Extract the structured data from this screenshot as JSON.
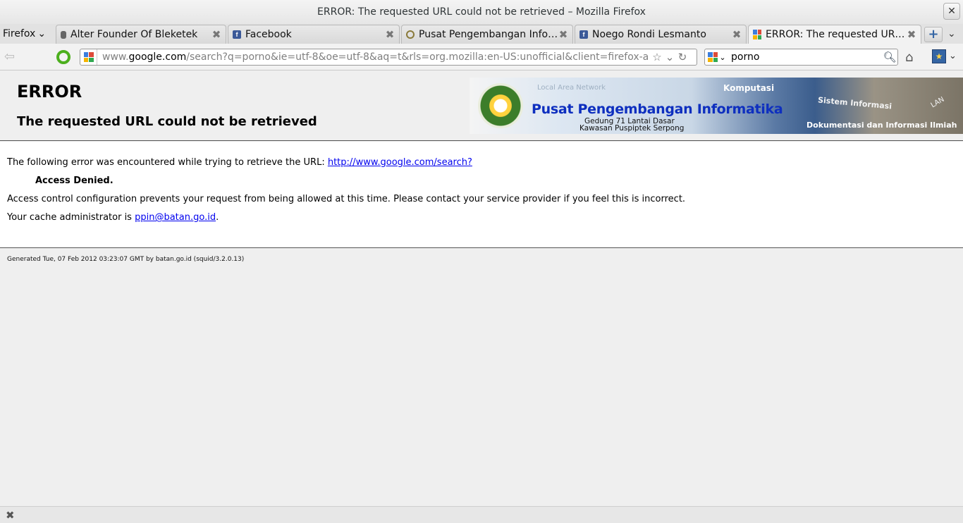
{
  "window": {
    "title": "ERROR: The requested URL could not be retrieved – Mozilla Firefox",
    "close_glyph": "✕"
  },
  "appmenu": {
    "label": "Firefox"
  },
  "tabs": [
    {
      "label": "Alter Founder Of Bleketek",
      "favicon": "lock-icon"
    },
    {
      "label": "Facebook",
      "favicon": "facebook-icon"
    },
    {
      "label": "Pusat Pengembangan Infor...",
      "favicon": "seal-icon"
    },
    {
      "label": "Noego Rondi Lesmanto",
      "favicon": "facebook-icon"
    },
    {
      "label": "ERROR: The requested URL...",
      "favicon": "google-icon",
      "active": true
    }
  ],
  "nav": {
    "url_prefix": "www.",
    "url_host": "google.com",
    "url_rest": "/search?q=porno&ie=utf-8&oe=utf-8&aq=t&rls=org.mozilla:en-US:unofficial&client=firefox-a",
    "search_value": "porno"
  },
  "page": {
    "h1": "ERROR",
    "h2": "The requested URL could not be retrieved",
    "line1": "The following error was encountered while trying to retrieve the URL: ",
    "line1_link": "http://www.google.com/search?",
    "denied": "Access Denied.",
    "line3": "Access control configuration prevents your request from being allowed at this time. Please contact your service provider if you feel this is incorrect.",
    "line4": "Your cache administrator is ",
    "line4_link": "ppin@batan.go.id",
    "line4_end": ".",
    "footer": "Generated Tue, 07 Feb 2012 03:23:07 GMT by batan.go.id (squid/3.2.0.13)"
  },
  "banner": {
    "network": "Local Area Network",
    "name": "Pusat Pengembangan Informatika",
    "address1": "Gedung 71 Lantai Dasar",
    "address2": "Kawasan Puspiptek Serpong",
    "komputasi": "Komputasi",
    "sistem": "Sistem Informasi",
    "lan": "LAN",
    "dokumentasi": "Dokumentasi dan Informasi Ilmiah"
  },
  "colors": {
    "link": "#0000ee",
    "banner_title": "#0e2fbf",
    "addon_green": "#4caf1e"
  }
}
